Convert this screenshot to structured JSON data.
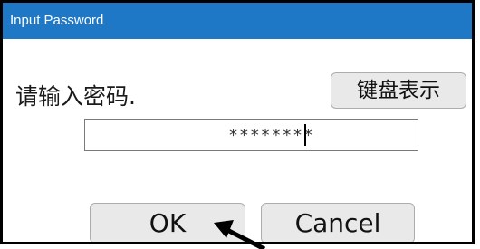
{
  "window": {
    "title": "Input Password",
    "title_color": "#1f78c6"
  },
  "prompt_text": "请输入密码.",
  "keyboard_button": {
    "label": "键盘表示"
  },
  "password_field": {
    "value": "********"
  },
  "buttons": {
    "ok_label": "OK",
    "cancel_label": "Cancel"
  },
  "annotation": {
    "icon": "arrow-pointer-icon"
  }
}
